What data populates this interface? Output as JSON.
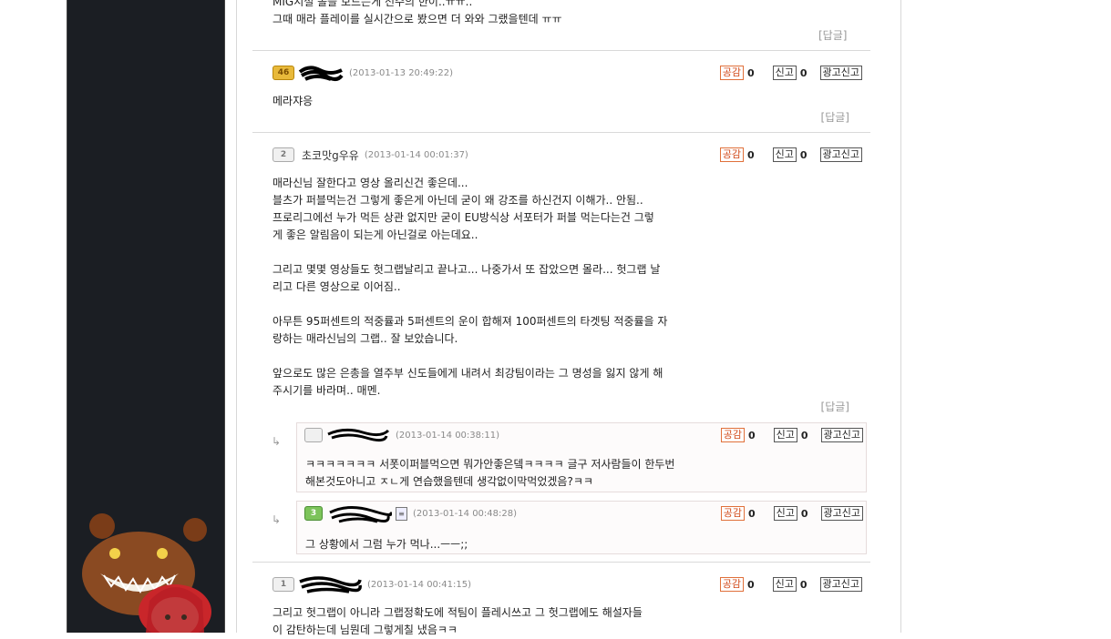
{
  "colors": {
    "sidebar_bg": "#1b1e23",
    "like_border": "#e0703a",
    "separator": "#d9d9d9"
  },
  "buttons": {
    "like": "공감",
    "report": "신고",
    "ad_report": "광고신고",
    "reply": "[답글]"
  },
  "comment0": {
    "lines": [
      "MIG시절 볼을 보드는게 선수의 한이..ㅠㅠ..",
      "그때 매라 플레이를 실시간으로 봤으면 더 와와 그랬을텐데 ㅠㅠ"
    ]
  },
  "comment1": {
    "level": "46",
    "level_icon": "gold-level-badge",
    "date": "(2013-01-13 20:49:22)",
    "likes": "0",
    "reports": "0",
    "lines": [
      "메라쟈응"
    ]
  },
  "comment2": {
    "level": "2",
    "nick": "초코맛g우유",
    "date": "(2013-01-14 00:01:37)",
    "likes": "0",
    "reports": "0",
    "lines": [
      "매라신님 잘한다고 영상 올리신건 좋은데...",
      "블츠가 퍼블먹는건 그렇게 좋은게 아닌데 굳이 왜 강조를 하신건지 이해가.. 안됨..",
      "프로리그에선 누가 먹든 상관 없지만 굳이 EU방식상 서포터가 퍼블 먹는다는건 그렇",
      "게 좋은 알림음이 되는게 아닌걸로 아는데요..",
      "",
      "그리고 몇몇 영상들도 헛그랩날리고 끝나고... 나중가서 또 잡았으면 몰라... 헛그랩 날",
      "리고 다른 영상으로 이어짐..",
      "",
      "아무튼 95퍼센트의 적중률과 5퍼센트의 운이 합해져 100퍼센트의 타겟팅 적중률을 자",
      "랑하는 매라신님의 그랩.. 잘 보았습니다.",
      "",
      "앞으로도 많은 은총을 열주부 신도들에게 내려서 최강팀이라는 그 명성을 잃지 않게 해",
      "주시기를 바라며.. 매멘."
    ]
  },
  "reply1": {
    "arrow": "↳",
    "date": "(2013-01-14 00:38:11)",
    "likes": "0",
    "reports": "0",
    "lines": [
      "ㅋㅋㅋㅋㅋㅋㅋ 서폿이퍼블먹으면 뭐가안좋은뎈ㅋㅋㅋㅋ  글구 저사람들이 한두번",
      "해본것도아니고 ㅈㄴ게 연습했을텐데 생각없이막먹었겠음?ㅋㅋ"
    ]
  },
  "reply2": {
    "arrow": "↳",
    "level": "3",
    "date": "(2013-01-14 00:48:28)",
    "likes": "0",
    "reports": "0",
    "lines": [
      "그 상황에서 그럼 누가 먹나...ㅡㅡ;;"
    ]
  },
  "comment3": {
    "level": "1",
    "date": "(2013-01-14 00:41:15)",
    "likes": "0",
    "reports": "0",
    "lines": [
      "그리고 헛그랩이 아니라 그랩정확도에 적팀이 플레시쓰고 그 헛그랩에도 해설자들",
      "이 감탄하는데 님뭔데 그렇게칠 냈음ㅋㅋ"
    ]
  }
}
